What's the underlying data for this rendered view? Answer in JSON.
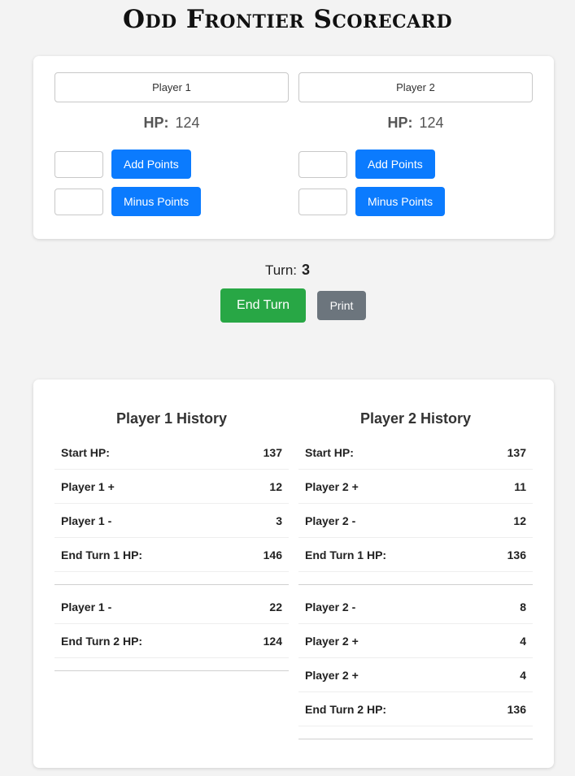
{
  "title": "Odd Frontier Scorecard",
  "players": [
    {
      "name": "Player 1",
      "hp_label": "HP:",
      "hp": "124",
      "add_label": "Add Points",
      "minus_label": "Minus Points"
    },
    {
      "name": "Player 2",
      "hp_label": "HP:",
      "hp": "124",
      "add_label": "Add Points",
      "minus_label": "Minus Points"
    }
  ],
  "turn": {
    "label": "Turn:",
    "value": "3"
  },
  "controls": {
    "end_turn": "End Turn",
    "print": "Print"
  },
  "history": [
    {
      "title": "Player 1 History",
      "turns": [
        [
          {
            "label": "Start HP:",
            "value": "137"
          },
          {
            "label": "Player 1 +",
            "value": "12"
          },
          {
            "label": "Player 1 -",
            "value": "3"
          },
          {
            "label": "End Turn 1 HP:",
            "value": "146"
          }
        ],
        [
          {
            "label": "Player 1 -",
            "value": "22"
          },
          {
            "label": "End Turn 2 HP:",
            "value": "124"
          }
        ]
      ]
    },
    {
      "title": "Player 2 History",
      "turns": [
        [
          {
            "label": "Start HP:",
            "value": "137"
          },
          {
            "label": "Player 2 +",
            "value": "11"
          },
          {
            "label": "Player 2 -",
            "value": "12"
          },
          {
            "label": "End Turn 1 HP:",
            "value": "136"
          }
        ],
        [
          {
            "label": "Player 2 -",
            "value": "8"
          },
          {
            "label": "Player 2 +",
            "value": "4"
          },
          {
            "label": "Player 2 +",
            "value": "4"
          },
          {
            "label": "End Turn 2 HP:",
            "value": "136"
          }
        ]
      ]
    }
  ],
  "colors": {
    "primary": "#0b7bfe",
    "success": "#28a745",
    "secondary": "#6c757d",
    "background": "#f3f3f3"
  }
}
